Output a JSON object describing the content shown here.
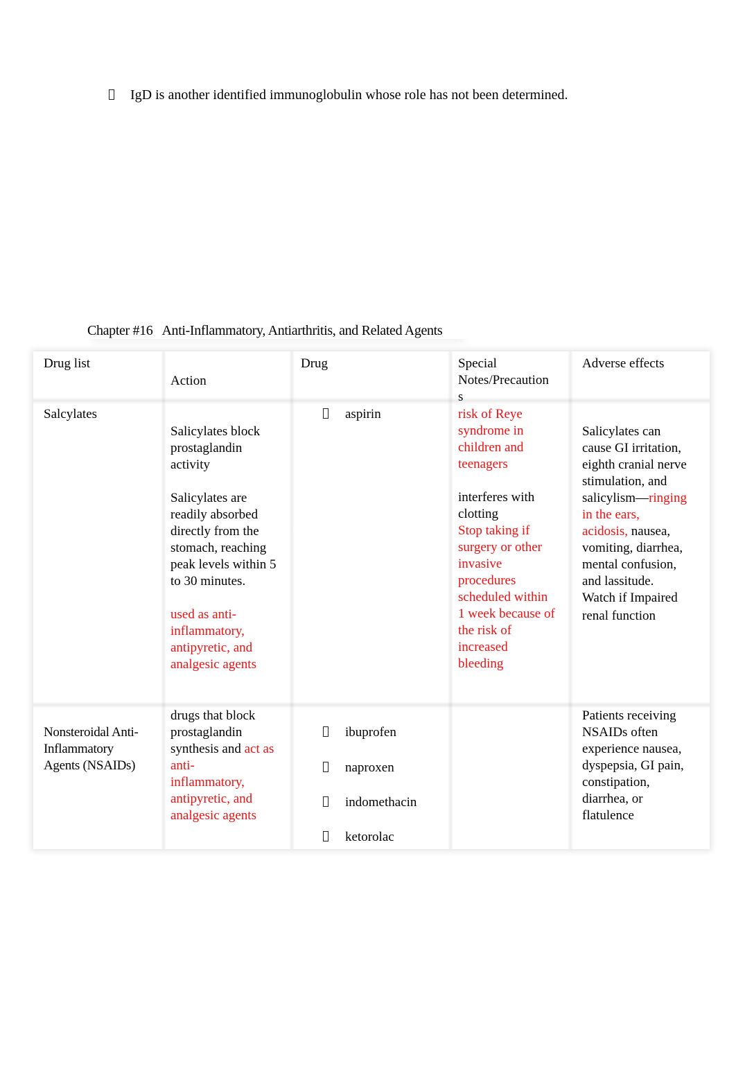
{
  "intro": {
    "bullet_icon": "bullet-box-icon",
    "text": "IgD is another identified immunoglobulin whose role has not been determined."
  },
  "chapter": {
    "number": "Chapter #16",
    "title": "Anti-Inflammatory, Antiarthritis, and Related Agents"
  },
  "table": {
    "headers": {
      "drug_list": "Drug list",
      "action": "Action",
      "drug": "Drug",
      "special_notes_line1": "Special",
      "special_notes_line2": "Notes/Precaution",
      "special_notes_line3": "s",
      "adverse_effects": "Adverse effects"
    },
    "rows": [
      {
        "drug_list": "Salcylates",
        "action": {
          "p1_lines": [
            "Salicylates block",
            "prostaglandin",
            "activity"
          ],
          "p2_lines": [
            "Salicylates are",
            "readily absorbed",
            "directly from the",
            "stomach, reaching",
            "peak levels within 5",
            "to 30 minutes."
          ],
          "p3_red_lines": [
            "used as anti-",
            "inflammatory,",
            "antipyretic, and",
            "analgesic agents"
          ]
        },
        "drugs": [
          "aspirin"
        ],
        "special_notes": {
          "red1_lines": [
            "risk of Reye",
            "syndrome in",
            "children and",
            "teenagers"
          ],
          "black_lines": [
            "interferes with",
            "clotting"
          ],
          "red2_lines": [
            "Stop taking if",
            "surgery or other",
            "invasive",
            "procedures",
            "scheduled within",
            "1 week because of",
            "the risk of",
            "increased",
            "bleeding"
          ]
        },
        "adverse_effects": {
          "lines_before": [
            "Salicylates can",
            "cause GI irritation,",
            "eighth cranial nerve",
            "stimulation, and"
          ],
          "salicylism_prefix": "salicylism—",
          "salicylism_red": "ringing",
          "red_line2": "in the ears,",
          "red_acidosis": "acidosis,",
          "after_acidosis": " nausea,",
          "lines_after": [
            "vomiting, diarrhea,",
            "mental confusion,",
            "and lassitude.",
            "Watch if Impaired",
            "renal function"
          ]
        }
      },
      {
        "drug_list_lines": [
          "Nonsteroidal Anti-",
          "Inflammatory",
          "Agents (NSAIDs)"
        ],
        "action": {
          "line1": "drugs that block",
          "line2": "prostaglandin",
          "line3_black": "synthesis and ",
          "line3_red": "act as",
          "red_lines": [
            "anti-",
            "inflammatory,",
            "antipyretic, and",
            "analgesic agents"
          ]
        },
        "drugs": [
          "ibuprofen",
          "naproxen",
          "indomethacin",
          "ketorolac"
        ],
        "special_notes": "",
        "adverse_effects_lines": [
          "Patients receiving",
          "NSAIDs often",
          "experience nausea,",
          "dyspepsia, GI pain,",
          "constipation,",
          "diarrhea, or",
          "flatulence"
        ]
      }
    ]
  },
  "colors": {
    "text": "#000000",
    "highlight_red": "#ee1111"
  }
}
